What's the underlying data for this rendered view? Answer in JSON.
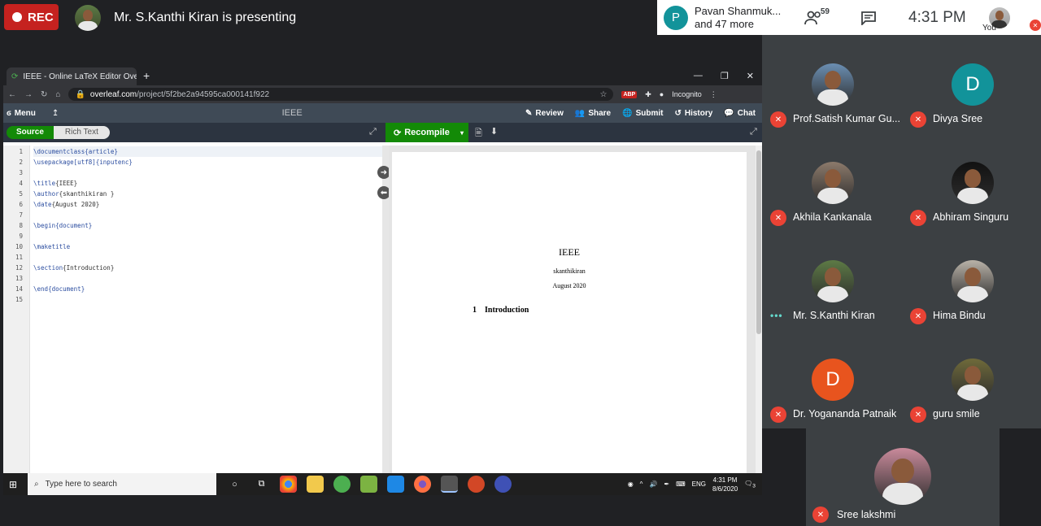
{
  "meet": {
    "rec_label": "REC",
    "presenting_text": "Mr. S.Kanthi Kiran is presenting",
    "presenter_info": {
      "initial": "P",
      "name": "Pavan Shanmuk...",
      "more": "and 47 more"
    },
    "participant_count": "59",
    "time": "4:31 PM",
    "you_label": "You"
  },
  "browser": {
    "tab_title": "IEEE - Online LaTeX Editor Overle",
    "new_tab": "+",
    "url_host": "overleaf.com",
    "url_path": "/project/5f2be2a94595ca000141f922",
    "abp_label": "ABP",
    "incognito_label": "Incognito"
  },
  "overleaf": {
    "menu_label": "Menu",
    "project_title": "IEEE",
    "review_label": "Review",
    "share_label": "Share",
    "submit_label": "Submit",
    "history_label": "History",
    "chat_label": "Chat",
    "source_label": "Source",
    "richtext_label": "Rich Text",
    "recompile_label": "Recompile"
  },
  "code_lines": [
    {
      "n": "1",
      "pre": "\\documentclass",
      "arg": "{article}",
      "post": ""
    },
    {
      "n": "2",
      "pre": "\\usepackage",
      "arg": "[utf8]{inputenc}",
      "post": ""
    },
    {
      "n": "3",
      "pre": "",
      "arg": "",
      "post": ""
    },
    {
      "n": "4",
      "pre": "\\title",
      "arg": "",
      "post": "{IEEE}"
    },
    {
      "n": "5",
      "pre": "\\author",
      "arg": "",
      "post": "{skanthikiran }"
    },
    {
      "n": "6",
      "pre": "\\date",
      "arg": "",
      "post": "{August 2020}"
    },
    {
      "n": "7",
      "pre": "",
      "arg": "",
      "post": ""
    },
    {
      "n": "8",
      "pre": "\\begin",
      "arg": "{document}",
      "post": ""
    },
    {
      "n": "9",
      "pre": "",
      "arg": "",
      "post": ""
    },
    {
      "n": "10",
      "pre": "\\maketitle",
      "arg": "",
      "post": ""
    },
    {
      "n": "11",
      "pre": "",
      "arg": "",
      "post": ""
    },
    {
      "n": "12",
      "pre": "\\section",
      "arg": "",
      "post": "{Introduction}"
    },
    {
      "n": "13",
      "pre": "",
      "arg": "",
      "post": ""
    },
    {
      "n": "14",
      "pre": "\\end",
      "arg": "{document}",
      "post": ""
    },
    {
      "n": "15",
      "pre": "",
      "arg": "",
      "post": ""
    }
  ],
  "pdf": {
    "title": "IEEE",
    "author": "skanthikiran",
    "date": "August 2020",
    "section_num": "1",
    "section_title": "Introduction"
  },
  "taskbar": {
    "search_placeholder": "Type here to search",
    "lang": "ENG",
    "time": "4:31 PM",
    "date": "8/6/2020",
    "notif_count": "3"
  },
  "participants": [
    {
      "name": "Prof.Satish Kumar Gu...",
      "initial": "",
      "color": "#6b8fb3",
      "status": "muted"
    },
    {
      "name": "Divya Sree",
      "initial": "D",
      "color": "#12939a",
      "status": "muted"
    },
    {
      "name": "Akhila Kankanala",
      "initial": "",
      "color": "#8c7a6b",
      "status": "muted"
    },
    {
      "name": "Abhiram Singuru",
      "initial": "",
      "color": "#111111",
      "status": "muted"
    },
    {
      "name": "Mr. S.Kanthi Kiran",
      "initial": "",
      "color": "#5d7a45",
      "status": "speaking"
    },
    {
      "name": "Hima Bindu",
      "initial": "",
      "color": "#b9b2a8",
      "status": "muted"
    },
    {
      "name": "Dr. Yogananda Patnaik",
      "initial": "D",
      "color": "#e8541e",
      "status": "muted"
    },
    {
      "name": "guru smile",
      "initial": "",
      "color": "#6f6a3a",
      "status": "muted"
    },
    {
      "name": "Sree lakshmi",
      "initial": "",
      "color": "#c98a9b",
      "status": "muted"
    }
  ]
}
